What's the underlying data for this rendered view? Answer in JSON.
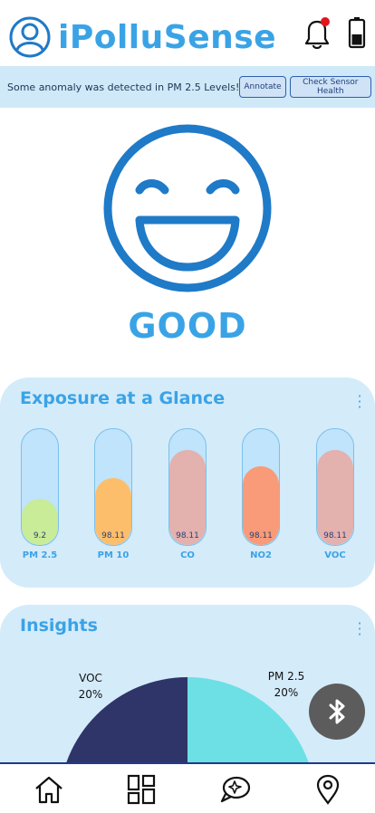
{
  "app": {
    "title": "iPolluSense"
  },
  "alert": {
    "message": "Some anomaly was detected in PM 2.5 Levels!",
    "annotate_label": "Annotate",
    "check_label": "Check Sensor Health"
  },
  "air_quality": {
    "status": "GOOD",
    "icon": "smiley-face-icon"
  },
  "exposure": {
    "title": "Exposure at a Glance",
    "gauges": [
      {
        "label": "PM 2.5",
        "value": "9.2",
        "level": 0.4,
        "color": "#c8ec98"
      },
      {
        "label": "PM 10",
        "value": "98.11",
        "level": 0.58,
        "color": "#fdbe6c"
      },
      {
        "label": "CO",
        "value": "98.11",
        "level": 0.82,
        "color": "#e3b1ae"
      },
      {
        "label": "NO2",
        "value": "98.11",
        "level": 0.68,
        "color": "#f99a78"
      },
      {
        "label": "VOC",
        "value": "98.11",
        "level": 0.82,
        "color": "#e3b1ae"
      }
    ]
  },
  "insights": {
    "title": "Insights",
    "slices": [
      {
        "label": "VOC",
        "pct": "20%",
        "color": "#2f3569"
      },
      {
        "label": "PM 2.5",
        "pct": "20%",
        "color": "#6ce0e4"
      }
    ]
  },
  "nav": {
    "items": [
      "home-icon",
      "dashboard-icon",
      "chat-icon",
      "location-icon"
    ]
  },
  "colors": {
    "accent": "#3aa3e6",
    "card_bg": "#d4ebfa",
    "alert_bg": "#cfe9f8",
    "nav_border": "#1e3a8a"
  }
}
